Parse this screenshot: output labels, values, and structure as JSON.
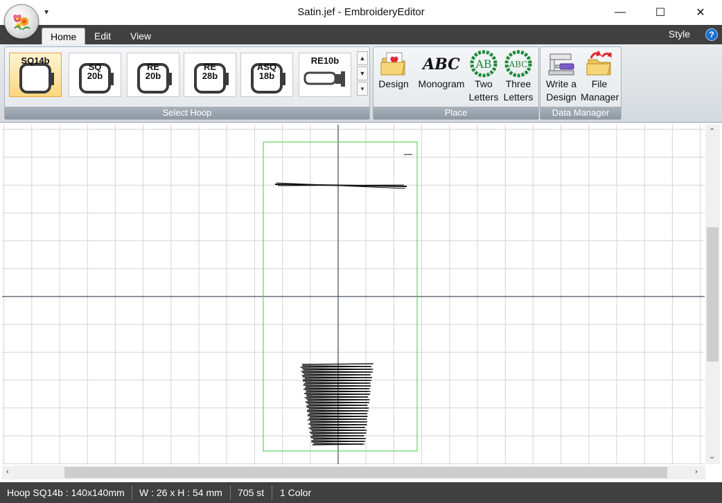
{
  "window": {
    "title": "Satin.jef - EmbroideryEditor",
    "qat_symbol": "▾",
    "minimize": "—",
    "maximize": "☐",
    "close": "✕"
  },
  "tabs": [
    {
      "label": "Home",
      "active": true
    },
    {
      "label": "Edit",
      "active": false
    },
    {
      "label": "View",
      "active": false
    }
  ],
  "style_label": "Style",
  "help_label": "?",
  "ribbon": {
    "select_hoop": {
      "label": "Select Hoop",
      "hoops": [
        "SQ14b",
        "SQ 20b",
        "RE 20b",
        "RE 28b",
        "ASQ 18b",
        "RE10b"
      ],
      "hoop_lines": [
        [
          "SQ14b"
        ],
        [
          "SQ",
          "20b"
        ],
        [
          "RE",
          "20b"
        ],
        [
          "RE",
          "28b"
        ],
        [
          "ASQ",
          "18b"
        ],
        [
          "RE10b"
        ]
      ],
      "selected": "SQ14b"
    },
    "place": {
      "label": "Place",
      "design": "Design",
      "monogram": "Monogram",
      "monogram_glyph": "ABC",
      "two_letters": [
        "Two",
        "Letters"
      ],
      "two_glyph": "AB",
      "three_letters": [
        "Three",
        "Letters"
      ],
      "three_glyph": "ABC"
    },
    "data_manager": {
      "label": "Data Manager",
      "write_design": [
        "Write a",
        "Design"
      ],
      "file_manager": [
        "File",
        "Manager"
      ]
    }
  },
  "statusbar": {
    "hoop": "Hoop SQ14b : 140x140mm",
    "size": "W : 26 x H : 54 mm",
    "stitches": "705 st",
    "colors": "1 Color"
  },
  "colors": {
    "hoop_outline": "#3ecf3e",
    "axis": "#1a2a3a",
    "grid": "#d4d4d4",
    "stitch": "#111111"
  }
}
